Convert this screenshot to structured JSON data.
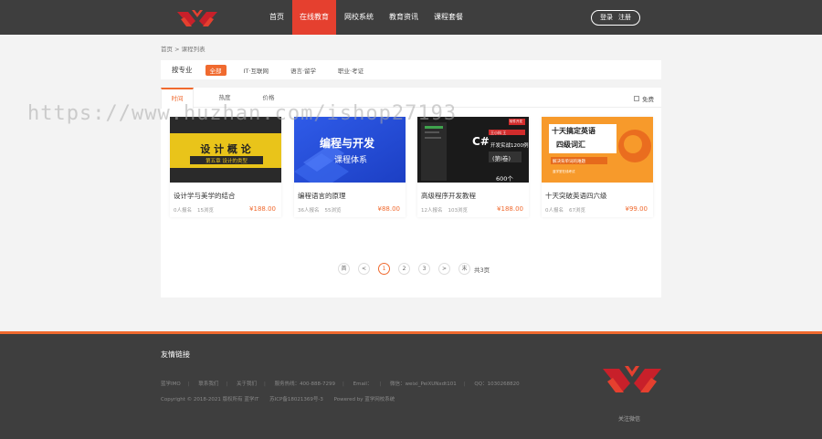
{
  "header": {
    "nav": [
      "首页",
      "在线教育",
      "网校系统",
      "教育资讯",
      "课程套餐"
    ],
    "login": "登录",
    "register": "注册",
    "brand_color": "#e5402f"
  },
  "breadcrumb": "首页 > 课程列表",
  "filter": {
    "label": "按专业",
    "options": [
      "全部",
      "IT·互联网",
      "语言·留学",
      "职业·考证"
    ]
  },
  "tabs": [
    "时间",
    "热度",
    "价格"
  ],
  "free_label": "免费",
  "courses": [
    {
      "title": "设计学与美学的结合",
      "students": "0人报名",
      "views": "15浏览",
      "price": "¥188.00",
      "thumb": {
        "line1": "设 计 概 论",
        "line2": "第五章  设计的类型"
      }
    },
    {
      "title": "编程语言的原理",
      "students": "36人报名",
      "views": "55浏览",
      "price": "¥88.00",
      "thumb": {
        "line1": "编程与开发",
        "line2": "课程体系"
      }
    },
    {
      "title": "高级程序开发教程",
      "students": "12人报名",
      "views": "103浏览",
      "price": "¥188.00",
      "thumb": {
        "line1": "C#",
        "line2": "开发实战1200例",
        "line3": "(第Ⅰ卷)",
        "line4": "600个",
        "tag": "软件开发",
        "tag2": "王小科 王 "
      }
    },
    {
      "title": "十天突破英语四六级",
      "students": "0人报名",
      "views": "67浏览",
      "price": "¥99.00",
      "thumb": {
        "line1": "十天搞定英语",
        "line2": "四级词汇",
        "line3": "解决背单词的难题",
        "line4": "蓝学堂在线考试"
      }
    }
  ],
  "pager": {
    "first": "首",
    "prev": "<",
    "pages": [
      "1",
      "2",
      "3"
    ],
    "next": ">",
    "last": "末",
    "total": "共3页"
  },
  "footer": {
    "friend_links": "友情链接",
    "links": [
      "蓝学IMO",
      "联系我们",
      "关于我们",
      "服务热线：400-888-7299",
      "Email：",
      "微信：weixi_PeiXUNxdt101",
      "QQ：1030268820"
    ],
    "copyright": [
      "Copyright © 2018-2021 版权所有 蓝学IT",
      "苏ICP备18021369号-3",
      "Powered by 蓝学网校系统"
    ],
    "follow": "关注微信"
  },
  "watermark": "https://www.huzhan.com/ishop27193"
}
